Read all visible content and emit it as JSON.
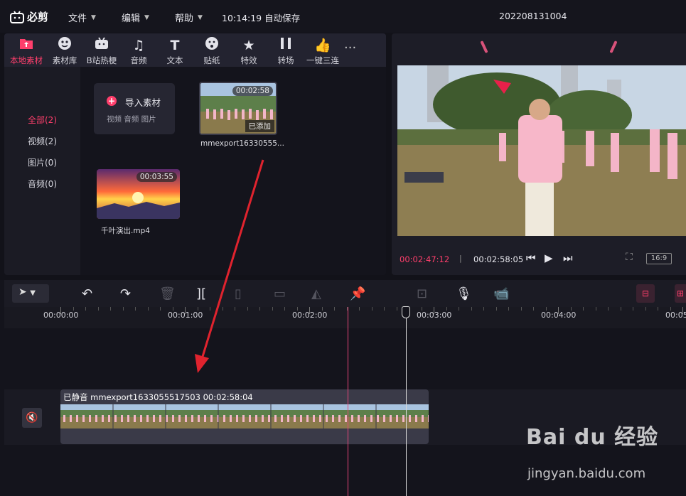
{
  "app": {
    "logo_text": "必剪",
    "menus": [
      {
        "label": "文件"
      },
      {
        "label": "编辑"
      },
      {
        "label": "帮助"
      }
    ],
    "autosave": "10:14:19 自动保存",
    "project_name": "202208131004"
  },
  "media_tabs": [
    {
      "label": "本地素材",
      "icon": "upload-icon"
    },
    {
      "label": "素材库",
      "icon": "face-icon"
    },
    {
      "label": "B站热梗",
      "icon": "tv-icon"
    },
    {
      "label": "音频",
      "icon": "music-note-icon"
    },
    {
      "label": "文本",
      "icon": "text-T-icon"
    },
    {
      "label": "贴纸",
      "icon": "sticker-icon"
    },
    {
      "label": "特效",
      "icon": "star-effect-icon"
    },
    {
      "label": "转场",
      "icon": "transition-icon"
    },
    {
      "label": "一键三连",
      "icon": "thumbs-up-icon"
    }
  ],
  "categories": [
    {
      "label": "全部(2)"
    },
    {
      "label": "视频(2)"
    },
    {
      "label": "图片(0)"
    },
    {
      "label": "音频(0)"
    }
  ],
  "import_card": {
    "label": "导入素材",
    "sub": "视频 音频 图片"
  },
  "clips": [
    {
      "name": "mmexport16330555...",
      "duration": "00:02:58",
      "badge": "已添加"
    },
    {
      "name": "千叶演出.mp4",
      "duration": "00:03:55"
    }
  ],
  "preview": {
    "current_time": "00:02:47:12",
    "separator": "|",
    "total_time": "00:02:58:05",
    "ratio": "16:9"
  },
  "timeline": {
    "ruler": [
      "00:00:00",
      "00:01:00",
      "00:02:00",
      "00:03:00",
      "00:04:00",
      "00:05"
    ],
    "clip_title": "已静音 mmexport1633055517503    00:02:58:04"
  },
  "watermark": {
    "main": "Bai du 经验",
    "sub": "jingyan.baidu.com"
  },
  "colors": {
    "accent": "#ff3f6c",
    "background": "#121219",
    "panel": "#1d1d27"
  }
}
